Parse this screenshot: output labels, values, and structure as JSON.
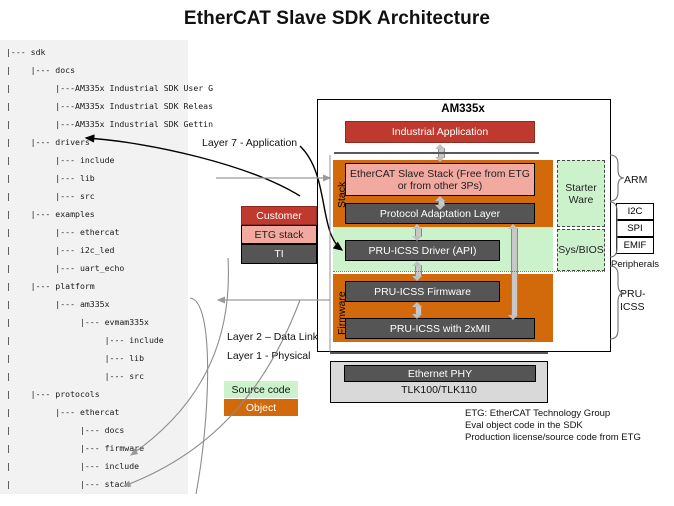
{
  "page": {
    "title": "EtherCAT Slave SDK Architecture"
  },
  "tree": {
    "rows": [
      {
        "indent": 0,
        "text": "|--- sdk"
      },
      {
        "indent": 1,
        "text": "|    |--- docs"
      },
      {
        "indent": 1,
        "text": "|         |---AM335x Industrial SDK User G"
      },
      {
        "indent": 1,
        "text": "|         |---AM335x Industrial SDK Releas"
      },
      {
        "indent": 1,
        "text": "|         |---AM335x Industrial SDK Gettin"
      },
      {
        "indent": 1,
        "text": "|    |--- drivers"
      },
      {
        "indent": 1,
        "text": "|         |--- include"
      },
      {
        "indent": 1,
        "text": "|         |--- lib"
      },
      {
        "indent": 1,
        "text": "|         |--- src"
      },
      {
        "indent": 1,
        "text": "|    |--- examples"
      },
      {
        "indent": 1,
        "text": "|         |--- ethercat"
      },
      {
        "indent": 1,
        "text": "|         |--- i2c_led"
      },
      {
        "indent": 1,
        "text": "|         |--- uart_echo"
      },
      {
        "indent": 1,
        "text": "|    |--- platform"
      },
      {
        "indent": 1,
        "text": "|         |--- am335x"
      },
      {
        "indent": 1,
        "text": "|              |--- evmam335x"
      },
      {
        "indent": 1,
        "text": "|                   |--- include"
      },
      {
        "indent": 1,
        "text": "|                   |--- lib"
      },
      {
        "indent": 1,
        "text": "|                   |--- src"
      },
      {
        "indent": 1,
        "text": "|    |--- protocols"
      },
      {
        "indent": 1,
        "text": "|         |--- ethercat"
      },
      {
        "indent": 1,
        "text": "|              |--- docs"
      },
      {
        "indent": 1,
        "text": "|              |--- firmware"
      },
      {
        "indent": 1,
        "text": "|              |--- include"
      },
      {
        "indent": 1,
        "text": "|              |--- stack"
      }
    ]
  },
  "diagram": {
    "soc_label": "AM335x",
    "blocks": {
      "industrial_application": "Industrial  Application",
      "ethercat_slave_stack": "EtherCAT  Slave Stack (Free from ETG  or from other 3Ps)",
      "protocol_adaptation_layer": "Protocol  Adaptation  Layer",
      "pruicss_driver": "PRU-ICSS   Driver (API)",
      "pruicss_firmware": "PRU-ICSS   Firmware",
      "pruicss_2xmii": "PRU-ICSS   with 2xMII",
      "starter_ware": "Starter Ware",
      "sysbios": "Sys/BIOS",
      "ethernet_phy": "Ethernet PHY",
      "phy_part": "TLK100/TLK110"
    },
    "side_labels": {
      "stack": "Stack",
      "firmware": "Firmware"
    },
    "layers": {
      "layer7": "Layer 7 - Application",
      "layer2": "Layer 2 – Data Link",
      "layer1": "Layer 1 - Physical"
    },
    "ownership": {
      "customer": "Customer",
      "etg_stack": "ETG  stack",
      "ti": "TI"
    },
    "right": {
      "arm": "ARM",
      "peripherals_label": "Peripherals",
      "peripherals": [
        "I2C",
        "SPI",
        "EMIF"
      ],
      "pruicss_line1": "PRU-",
      "pruicss_line2": "ICSS"
    },
    "legend": {
      "source_code": "Source code",
      "object": "Object"
    },
    "footnotes": [
      "ETG: EtherCAT Technology Group",
      "Eval object code in the SDK",
      "Production license/source code from ETG"
    ]
  },
  "colors": {
    "red": "#c0392e",
    "pink": "#f1a9a0",
    "gray": "#555555",
    "orange": "#d2690a",
    "green": "#ccf2cc",
    "panel": "#f2f2f2",
    "rule": "#595959"
  }
}
